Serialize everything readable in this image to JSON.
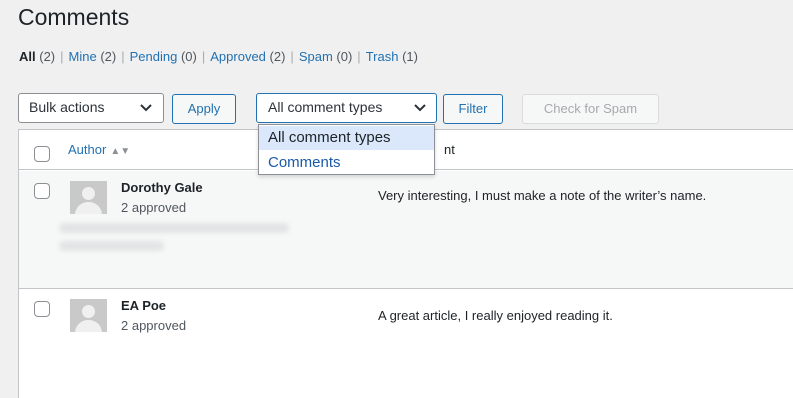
{
  "page": {
    "title": "Comments"
  },
  "filters": [
    {
      "label": "All",
      "count": "(2)"
    },
    {
      "label": "Mine",
      "count": "(2)"
    },
    {
      "label": "Pending",
      "count": "(0)"
    },
    {
      "label": "Approved",
      "count": "(2)"
    },
    {
      "label": "Spam",
      "count": "(0)"
    },
    {
      "label": "Trash",
      "count": "(1)"
    }
  ],
  "toolbar": {
    "bulk_actions": "Bulk actions",
    "apply": "Apply",
    "comment_type": "All comment types",
    "filter": "Filter",
    "check_spam": "Check for Spam"
  },
  "dropdown": {
    "options": [
      "All comment types",
      "Comments"
    ],
    "selected_index": 0
  },
  "table": {
    "headers": {
      "author": "Author",
      "comment": "nt"
    },
    "rows": [
      {
        "author": "Dorothy Gale",
        "meta": "2 approved",
        "comment": "Very interesting, I must make a note of the writer’s name."
      },
      {
        "author": "EA Poe",
        "meta": "2 approved",
        "comment": "A great article, I really enjoyed reading it."
      }
    ]
  },
  "colors": {
    "link": "#2271b1",
    "page_bg": "#f0f0f1",
    "highlight": "#dbe8fb"
  }
}
